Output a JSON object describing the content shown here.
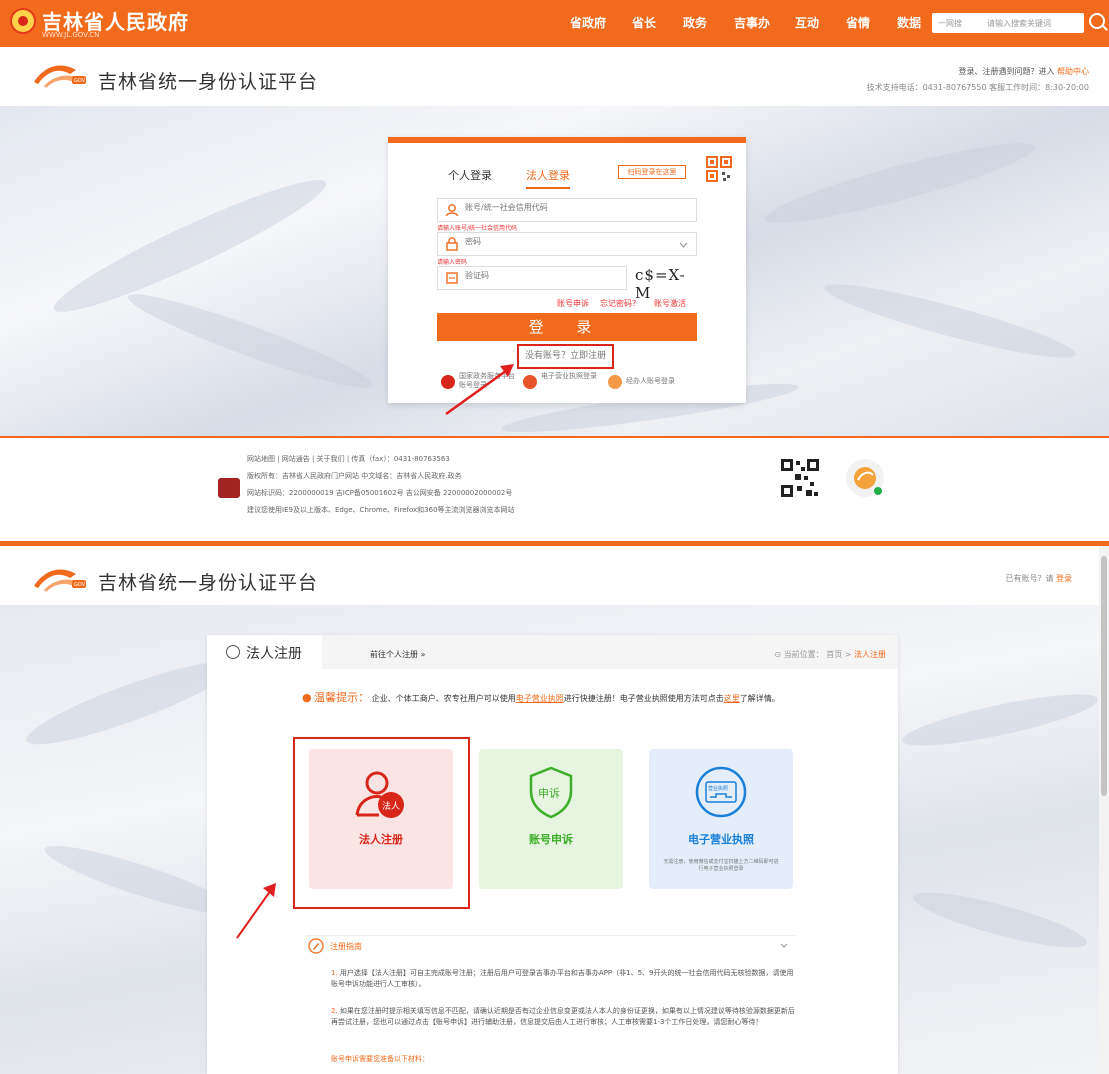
{
  "govbar": {
    "title": "吉林省人民政府",
    "subtitle": "WWW.JL.GOV.CN",
    "nav": [
      "省政府",
      "省长",
      "政务",
      "吉事办",
      "互动",
      "省情",
      "数据"
    ],
    "search_scope": "一网搜",
    "search_placeholder": "请输入搜索关键词"
  },
  "platform": {
    "title": "吉林省统一身份认证平台",
    "help_prefix": "登录、注册遇到问题？进入",
    "help_link": "帮助中心",
    "support": "技术支持电话：0431-80767550  客服工作时间：8:30-20:00",
    "have_account": "已有账号？请",
    "login_link": "登录"
  },
  "login": {
    "tab_personal": "个人登录",
    "tab_legal": "法人登录",
    "scan_tip": "扫码登录在这里",
    "account_placeholder": "账号/统一社会信用代码",
    "account_error": "请输入账号/统一社会信用代码",
    "password_placeholder": "密码",
    "password_error": "请输入密码",
    "captcha_placeholder": "验证码",
    "captcha_text": "c$=X-M",
    "link_appeal": "账号申诉",
    "link_forgot": "忘记密码？",
    "link_activate": "账号激活",
    "submit": "登 录",
    "register": "没有账号？立即注册",
    "alt_national": "国家政务服务平台账号登录",
    "alt_license": "电子营业执照登录",
    "alt_agent": "经办人账号登录"
  },
  "footer": {
    "links": "网站地图  |  网站通告  |  关于我们  |  传真（fax）：0431-80763563",
    "copyright": "版权所有：吉林省人民政府门户网站   中文域名：吉林省人民政府.政务",
    "icp": "网站标识码：2200000019   吉ICP备05001602号   吉公网安备 22000002000002号",
    "browser": "建议您使用IE9及以上版本、Edge、Chrome、Firefox和360等主流浏览器浏览本网站"
  },
  "register": {
    "tab": "法人注册",
    "to_personal": "前往个人注册 »",
    "location_label": "当前位置：",
    "crumb_home": "首页",
    "crumb_sep": ">",
    "crumb_current": "法人注册",
    "notice_label": "温馨提示：",
    "notice_a": "企业、个体工商户、农专社用户可以使用",
    "notice_link": "电子营业执照",
    "notice_b": "进行快捷注册！电子营业执照使用方法可点击",
    "notice_here": "这里",
    "notice_c": "了解详情。",
    "card_legal": "法人注册",
    "card_legal_badge": "法人",
    "card_appeal": "账号申诉",
    "card_appeal_badge": "申诉",
    "card_license": "电子营业执照",
    "card_license_badge": "营业执照",
    "card_license_desc": "无需注册，使用微信或支付宝扫描上方二维码即可进行电子营业执照登录",
    "guide_title": "注册指南",
    "guide_p1": "用户选择【法人注册】可自主完成账号注册；注册后用户可登录吉事办平台和吉事办APP（非1、5、9开头的统一社会信用代码无核验数据，请使用账号申诉功能进行人工审核）。",
    "guide_p2": "如果在您注册时提示相关填写信息不匹配，请确认近期是否有过企业信息变更或法人本人的身份证更换，如果有以上情况建议等待核验源数据更新后再尝试注册，您也可以通过点击【账号申诉】进行辅助注册，信息提交后由人工进行审核；人工审核需要1-3个工作日处理，请您耐心等待！",
    "guide_p3": "账号申诉需要您准备以下材料："
  },
  "colors": {
    "accent": "#f26a1b",
    "alert": "#d8261a"
  }
}
